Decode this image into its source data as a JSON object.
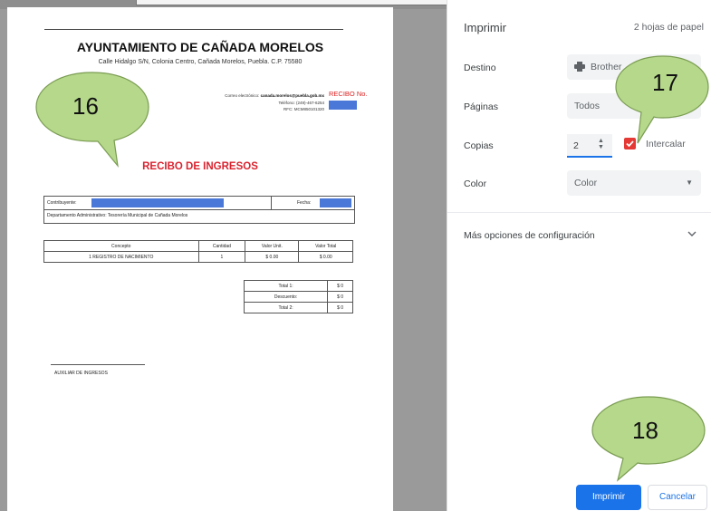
{
  "document": {
    "title": "AYUNTAMIENTO DE CAÑADA MORELOS",
    "address": "Calle Hidalgo S/N, Colonia Centro, Cañada Morelos, Puebla. C.P. 75580",
    "contact_prefix": "Correo electrónico:",
    "contact_email": "canada.morelos@puebla.gob.mx",
    "contact_phone": "Teléfono: (249)-467-6254",
    "contact_rfc": "RFC: MCM850101320",
    "recibo_no_label": "RECIBO No.",
    "recibo_title": "RECIBO DE INGRESOS",
    "contribuyente_label": "Contribuyente:",
    "fecha_label": "Fecha:",
    "departamento": "Departamento Administrativo: Tesorería Municipal de Cañada Morelos",
    "items_headers": [
      "Concepto",
      "Cantidad",
      "Valor Unit.",
      "Valor Total"
    ],
    "items_rows": [
      [
        "1 REGISTRO DE NACIMIENTO",
        "1",
        "$ 0.00",
        "$ 0.00"
      ]
    ],
    "totals": [
      [
        "Total 1:",
        "$ 0"
      ],
      [
        "Descuento:",
        "$ 0"
      ],
      [
        "Total 2:",
        "$ 0"
      ]
    ],
    "signature_label": "AUXILIAR DE INGRESOS",
    "redaction_color": "#4a78d8"
  },
  "print_panel": {
    "title": "Imprimir",
    "sheets": "2 hojas de papel",
    "destino_label": "Destino",
    "destino_value": "Brother",
    "destino_icon": "printer-icon",
    "paginas_label": "Páginas",
    "paginas_value": "Todos",
    "copias_label": "Copias",
    "copias_value": "2",
    "intercalar_label": "Intercalar",
    "intercalar_checked": true,
    "color_label": "Color",
    "color_value": "Color",
    "mas_opciones": "Más opciones de configuración",
    "print_button": "Imprimir",
    "cancel_button": "Cancelar",
    "accent_color": "#1a73e8",
    "checkbox_color": "#e53935"
  },
  "callouts": [
    {
      "number": "16",
      "color": "#b5d88a"
    },
    {
      "number": "17",
      "color": "#b5d88a"
    },
    {
      "number": "18",
      "color": "#b5d88a"
    }
  ]
}
